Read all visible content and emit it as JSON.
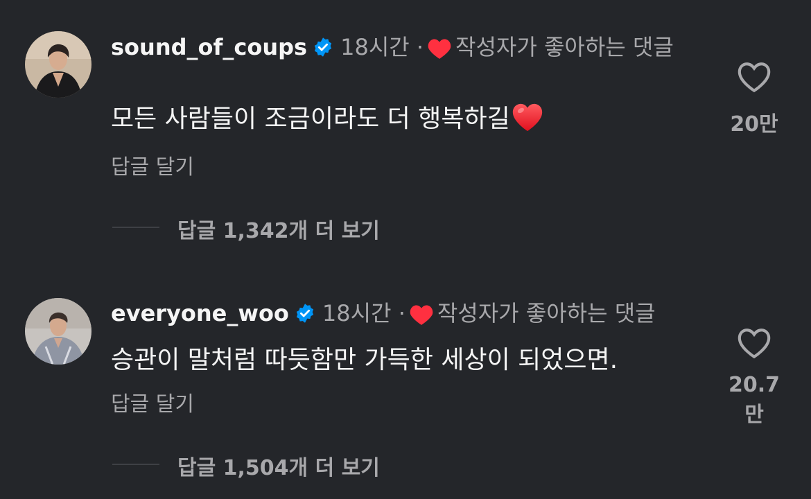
{
  "comments": [
    {
      "username": "sound_of_coups",
      "time": "18시간",
      "dot": "·",
      "creator_liked": "작성자가 좋아하는 댓글",
      "text": "모든 사람들이 조금이라도 더 행복하길",
      "reply_label": "답글 달기",
      "view_replies": "답글 1,342개 더 보기",
      "like_count": "20만"
    },
    {
      "username": "everyone_woo",
      "time": "18시간",
      "dot": "·",
      "creator_liked": "작성자가 좋아하는 댓글",
      "text": "승관이 말처럼 따듯함만 가득한 세상이 되었으면.",
      "reply_label": "답글 달기",
      "view_replies": "답글 1,504개 더 보기",
      "like_count": "20.7만"
    }
  ],
  "icons": {
    "verified": "verified-badge-icon",
    "creator_heart": "heart-filled-icon",
    "emoji": "red-heart-emoji-icon",
    "like": "heart-outline-icon"
  },
  "colors": {
    "background": "#24262a",
    "text_primary": "#f5f5f5",
    "text_secondary": "#a8a8ab",
    "verified_blue": "#0095f6",
    "heart_red": "#ff3040"
  }
}
